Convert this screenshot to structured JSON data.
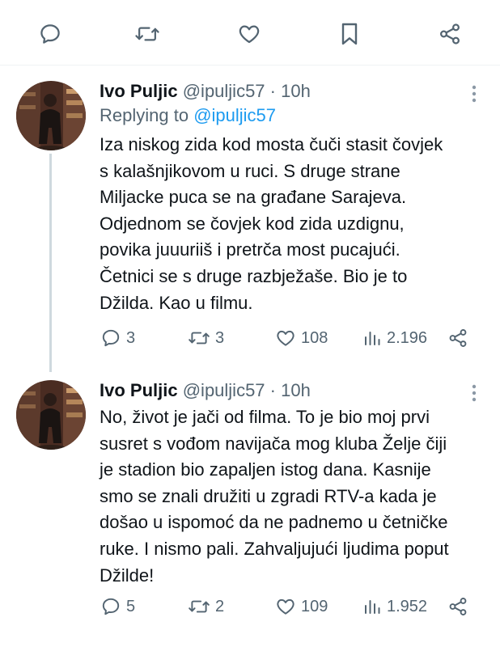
{
  "colors": {
    "text": "#0f1419",
    "secondary": "#536471",
    "accent": "#1d9bf0",
    "line": "#cfd9de"
  },
  "top_actions": [
    "reply-icon",
    "retweet-icon",
    "like-icon",
    "bookmark-icon",
    "share-icon"
  ],
  "tweets": [
    {
      "name": "Ivo Puljic",
      "handle": "@ipuljic57",
      "dot": "·",
      "time": "10h",
      "replying_prefix": "Replying to",
      "replying_to": "@ipuljic57",
      "text": "Iza niskog zida kod mosta čuči stasit čovjek\ns kalašnjikovom u ruci. S druge strane\nMiljacke puca se na građane Sarajeva.\nOdjednom se čovjek kod zida uzdignu,\npovika juuuriiš i pretrča most pucajući.\nČetnici se s druge razbježaše. Bio je to\nDžilda. Kao u filmu.",
      "replies": "3",
      "retweets": "3",
      "likes": "108",
      "views": "2.196"
    },
    {
      "name": "Ivo Puljic",
      "handle": "@ipuljic57",
      "dot": "·",
      "time": "10h",
      "text": "No, život je jači od filma. To je bio moj prvi\nsusret s vođom navijača mog kluba Želje čiji\nje stadion bio zapaljen istog dana. Kasnije\nsmo se znali družiti u zgradi RTV-a kada je\ndošao u ispomoć da ne padnemo u četničke\nruke. I nismo pali. Zahvaljujući ljudima poput\nDžilde!",
      "replies": "5",
      "retweets": "2",
      "likes": "109",
      "views": "1.952"
    }
  ]
}
